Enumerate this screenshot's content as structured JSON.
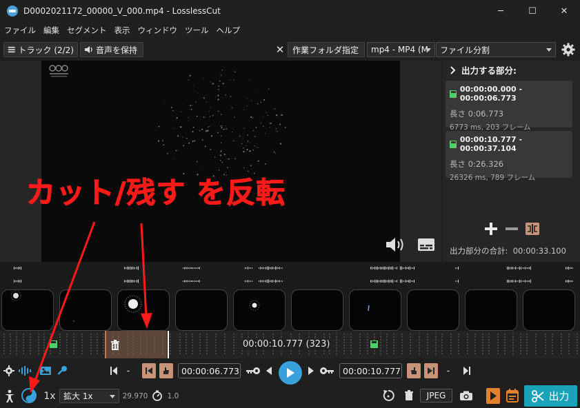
{
  "window": {
    "title": "D0002021172_00000_V_000.mp4 - LosslessCut",
    "minimize": "─",
    "maximize": "☐",
    "close": "✕"
  },
  "menu": [
    "ファイル",
    "編集",
    "セグメント",
    "表示",
    "ウィンドウ",
    "ツール",
    "ヘルプ"
  ],
  "toolbar": {
    "tracks_label": "トラック (2/2)",
    "keep_audio_label": "音声を保持",
    "work_folder_label": "作業フォルダ指定",
    "format_select": "mp4 - MP4 (M",
    "mode_select": "ファイル分割"
  },
  "segments_panel": {
    "header": "出力する部分:",
    "segments": [
      {
        "range": "00:00:00.000 - 00:00:06.773",
        "length": "長さ 0:06.773",
        "detail": "6773 ms, 203 フレーム"
      },
      {
        "range": "00:00:10.777 - 00:00:37.104",
        "length": "長さ 0:26.326",
        "detail": "26326 ms, 789 フレーム"
      }
    ],
    "total_label": "出力部分の合計:",
    "total_value": "00:00:33.100"
  },
  "timeline": {
    "current_label": "00:00:10.777 (323)"
  },
  "controls": {
    "dash1": "-",
    "dash2": "-",
    "start_time": "00:00:06.773",
    "end_time": "00:00:10.777",
    "speed": "1x",
    "zoom_select": "拡大 1x",
    "fps": "29.970",
    "fps_multiplier": "1.0",
    "capture_format": "JPEG",
    "export_label": "出力"
  },
  "annotation": {
    "text": "カット/残す を反転"
  },
  "colors": {
    "accent": "#3aa0dc",
    "export": "#1aa3b8",
    "segment_green": "#4fd16a",
    "annotation_red": "#ff1a1a"
  }
}
